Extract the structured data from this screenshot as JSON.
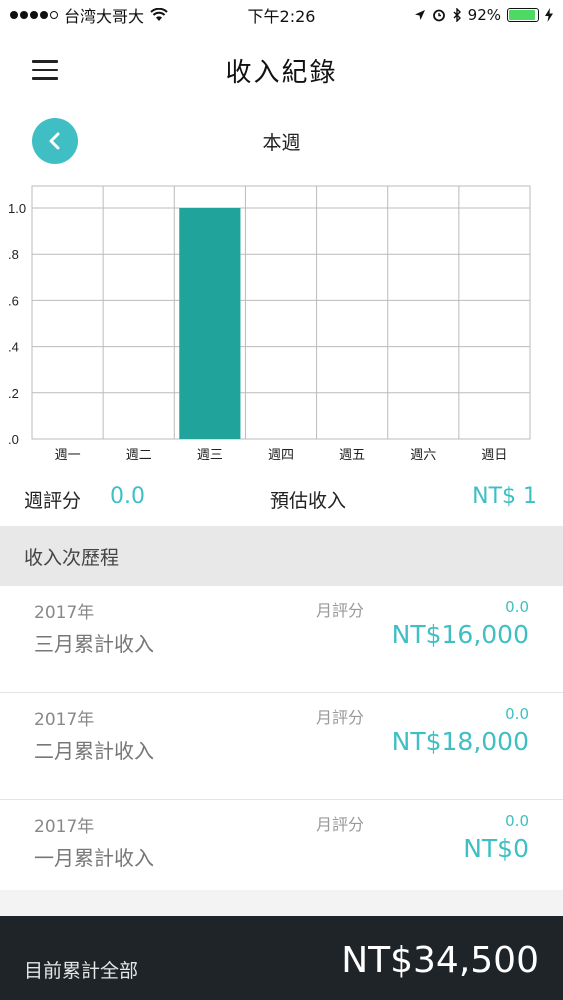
{
  "status_bar": {
    "carrier": "台湾大哥大",
    "time": "下午2:26",
    "battery": "92%",
    "battery_level": 0.92
  },
  "header": {
    "title": "收入紀錄"
  },
  "week": {
    "label": "本週"
  },
  "chart_data": {
    "type": "bar",
    "categories": [
      "週一",
      "週二",
      "週三",
      "週四",
      "週五",
      "週六",
      "週日"
    ],
    "values": [
      0,
      0,
      1.0,
      0,
      0,
      0,
      0
    ],
    "ylim": [
      0,
      1.0
    ],
    "y_ticks": [
      ".0",
      ".2",
      ".4",
      ".6",
      ".8",
      "1.0"
    ],
    "grid": true,
    "bar_color": "#1fa39a"
  },
  "summary": {
    "weekly_rating_label": "週評分",
    "weekly_rating_value": "0.0",
    "estimated_income_label": "預估收入",
    "estimated_income_value": "NT$ 1"
  },
  "history": {
    "header": "收入次歷程",
    "items": [
      {
        "year": "2017年",
        "month": "三月累計收入",
        "rating_label": "月評分",
        "rating": "0.0",
        "amount": "NT$16,000"
      },
      {
        "year": "2017年",
        "month": "二月累計收入",
        "rating_label": "月評分",
        "rating": "0.0",
        "amount": "NT$18,000"
      },
      {
        "year": "2017年",
        "month": "一月累計收入",
        "rating_label": "月評分",
        "rating": "0.0",
        "amount": "NT$0"
      }
    ]
  },
  "footer": {
    "label": "目前累計全部",
    "total": "NT$34,500"
  },
  "colors": {
    "accent": "#3fbfc4",
    "bar": "#1fa39a",
    "footer_bg": "#1f2428"
  }
}
